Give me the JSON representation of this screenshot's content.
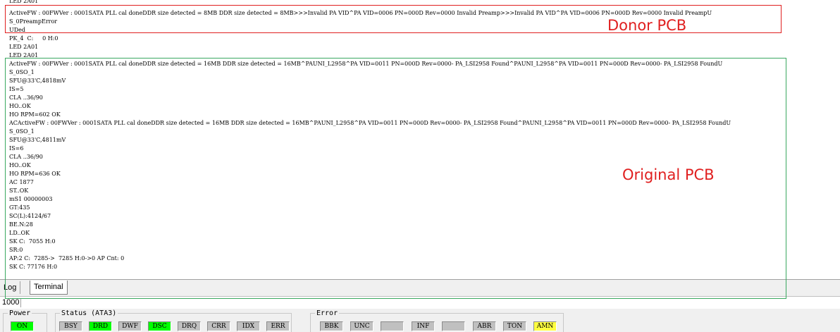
{
  "terminal": {
    "lines": [
      "LED 2A01",
      "ActiveFW : 00FWVer : 0001SATA PLL cal doneDDR size detected = 8MB DDR size detected = 8MB>>>Invalid PA VID^PA VID=0006 PN=000D Rev=0000 Invalid Preamp>>>Invalid PA VID^PA VID=0006 PN=000D Rev=0000 Invalid PreampU",
      "S_0PreampError",
      "UDed",
      "PK_4  C:     0 H:0",
      "LED 2A01",
      "LED 2A01",
      "ActiveFW : 00FWVer : 0001SATA PLL cal doneDDR size detected = 16MB DDR size detected = 16MB^PAUNI_L2958^PA VID=0011 PN=000D Rev=0000- PA_LSI2958 Found^PAUNI_L2958^PA VID=0011 PN=000D Rev=0000- PA_LSI2958 FoundU",
      "S_0SO_1",
      "SFU@33'C,4818mV",
      "IS=5",
      "CLA ..36/90",
      "HO..OK",
      "HO RPM=602 OK",
      "ACActiveFW : 00FWVer : 0001SATA PLL cal doneDDR size detected = 16MB DDR size detected = 16MB^PAUNI_L2958^PA VID=0011 PN=000D Rev=0000- PA_LSI2958 Found^PAUNI_L2958^PA VID=0011 PN=000D Rev=0000- PA_LSI2958 FoundU",
      "S_0SO_1",
      "SFU@33'C,4811mV",
      "IS=6",
      "CLA ..36/90",
      "HO..OK",
      "HO RPM=636 OK",
      "AC 1877",
      "ST..OK",
      "mS1 00000003",
      "GT:435",
      "SC(L):4124/67",
      "BE.N:28",
      "LD..OK",
      "SK C:  7055 H:0",
      "SR:0",
      "AP:2 C:  7285->  7285 H:0->0 AP Cnt: 0",
      "SK C: 77176 H:0"
    ],
    "line_number": "1000"
  },
  "annotations": {
    "donor": "Donor PCB",
    "original": "Original PCB"
  },
  "tabs": [
    "Log",
    "Terminal"
  ],
  "groups": {
    "power": {
      "title": "Power",
      "items": [
        {
          "label": "ON",
          "color": "green"
        }
      ]
    },
    "status": {
      "title": "Status (ATA3)",
      "items": [
        {
          "label": "BSY",
          "color": "gray"
        },
        {
          "label": "DRD",
          "color": "green"
        },
        {
          "label": "DWF",
          "color": "gray"
        },
        {
          "label": "DSC",
          "color": "green"
        },
        {
          "label": "DRQ",
          "color": "gray"
        },
        {
          "label": "CRR",
          "color": "gray"
        },
        {
          "label": "IDX",
          "color": "gray"
        },
        {
          "label": "ERR",
          "color": "gray"
        }
      ]
    },
    "error": {
      "title": "Error",
      "items": [
        {
          "label": "BBK",
          "color": "gray"
        },
        {
          "label": "UNC",
          "color": "gray"
        },
        {
          "label": "",
          "color": "gray"
        },
        {
          "label": "INF",
          "color": "gray"
        },
        {
          "label": "",
          "color": "gray"
        },
        {
          "label": "ABR",
          "color": "gray"
        },
        {
          "label": "TON",
          "color": "gray"
        },
        {
          "label": "AMN",
          "color": "yellow"
        }
      ]
    }
  },
  "colors": {
    "annotation_red": "#e02020",
    "annotation_green": "#3aa860",
    "indicator_on": "#00ff00",
    "indicator_warn": "#ffff40"
  }
}
